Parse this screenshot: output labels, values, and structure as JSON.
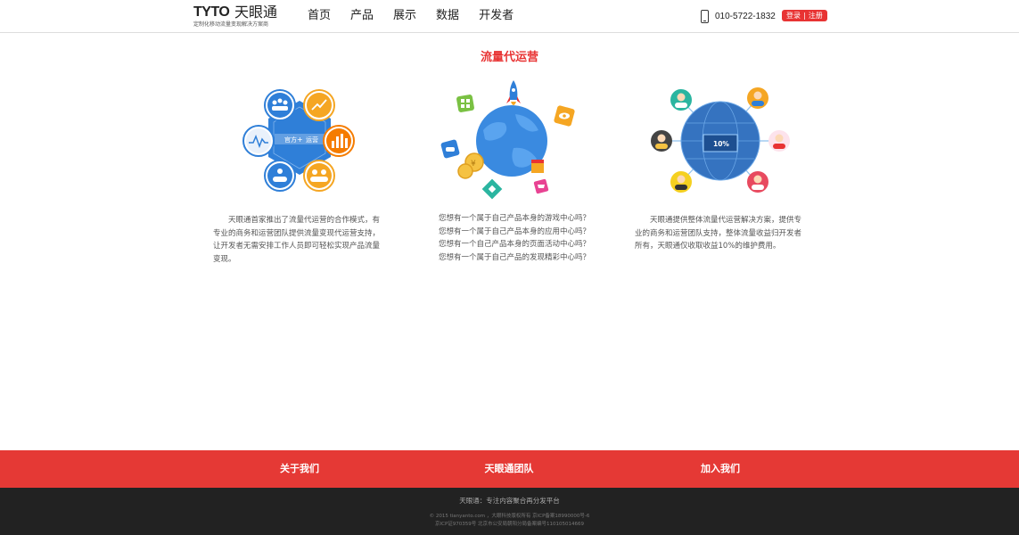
{
  "header": {
    "logo_mark": "TYTO",
    "logo_cn": "天眼通",
    "logo_tagline": "定制化移动流量变现解决方案商",
    "nav": [
      "首页",
      "产品",
      "展示",
      "数据",
      "开发者"
    ],
    "phone": "010-5722-1832",
    "login": "登录",
    "divider": "|",
    "register": "注册"
  },
  "section_title": "流量代运营",
  "illustrations": {
    "hub_left_text": "官方",
    "hub_plus": "+",
    "hub_right_text": "运营",
    "screen_text": "10%"
  },
  "columns": [
    {
      "lines": [
        "天眼通首家推出了流量代运营的合作模式，有",
        "专业的商务和运营团队提供流量变现代运营支持，",
        "让开发者无需安排工作人员即可轻松实现产品流量",
        "变现。"
      ]
    },
    {
      "lines": [
        "您想有一个属于自己产品本身的游戏中心吗？",
        "您想有一个属于自己产品本身的应用中心吗？",
        "您想有一个自己产品本身的页面活动中心吗？",
        "您想有一个属于自己产品的发现精彩中心吗？"
      ]
    },
    {
      "lines": [
        "天眼通提供整体流量代运营解决方案，提供专",
        "业的商务和运营团队支持，整体流量收益归开发者",
        "所有，天眼通仅收取收益10%的维护费用。"
      ]
    }
  ],
  "footer": {
    "links": [
      "关于我们",
      "天眼通团队",
      "加入我们"
    ],
    "slogan": "天眼通：专注内容聚合再分发平台",
    "copyright": "© 2015 tianyanto.com ，大眼科技版权所有  京ICP备案18990000号-6",
    "icp": "京ICP证970359号  北京市公安局朝阳分局备案编号110105014669"
  },
  "colors": {
    "accent": "#e83333",
    "footer_red": "#e53935",
    "footer_dark": "#222222",
    "globe_blue": "#2f7fd8"
  }
}
